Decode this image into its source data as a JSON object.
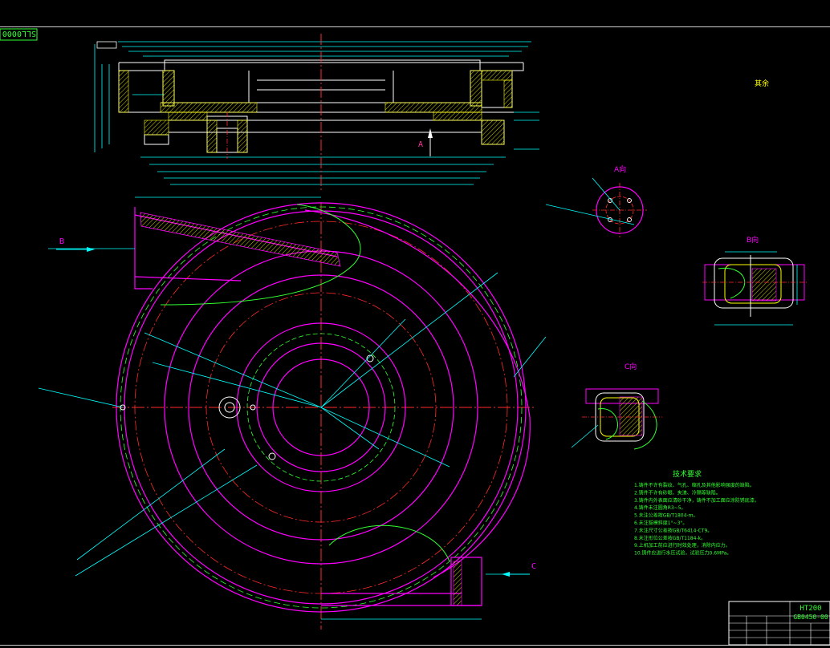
{
  "drawing_number_stamp": "SLL0000.5",
  "main_view_labels": {
    "view_arrow_a": "A",
    "view_arrow_b": "B",
    "view_arrow_c": "C",
    "rest_note": "其余"
  },
  "detail_views": {
    "a_view": {
      "title": "A向"
    },
    "b_view": {
      "title": "B向"
    },
    "c_view": {
      "title": "C向"
    }
  },
  "technical_requirements": {
    "heading": "技术要求",
    "items": [
      "1.铸件不许有裂纹、气孔、缩孔及其他影响强度的缺陷。",
      "2.铸件不许有砂眼、夹渣、冷隔等缺陷。",
      "3.铸件内外表面应清砂干净，铸件不加工面应涂防锈底漆。",
      "4.铸件未注圆角R3~5。",
      "5.未注公差按GB/T1804-m。",
      "6.未注拔模斜度1°~3°。",
      "7.未注尺寸公差按GB/T6414-CT9。",
      "8.未注形位公差按GB/T1184-k。",
      "9.上机加工前应进行时效处理，消除内应力。",
      "10.铸件应进行水压试验，试验压力0.6MPa。"
    ]
  },
  "title_block": {
    "material": "HT200",
    "drawing_code": "GB0450-00"
  },
  "colors": {
    "background": "#000000",
    "outline": "#ffffff",
    "dimension": "#00ffff",
    "center_line": "#ff2a2a",
    "volute_outline": "#ff00ff",
    "hidden_line": "#33ff33",
    "section_hatch": "#ffff00",
    "notes": "#33ff33"
  }
}
